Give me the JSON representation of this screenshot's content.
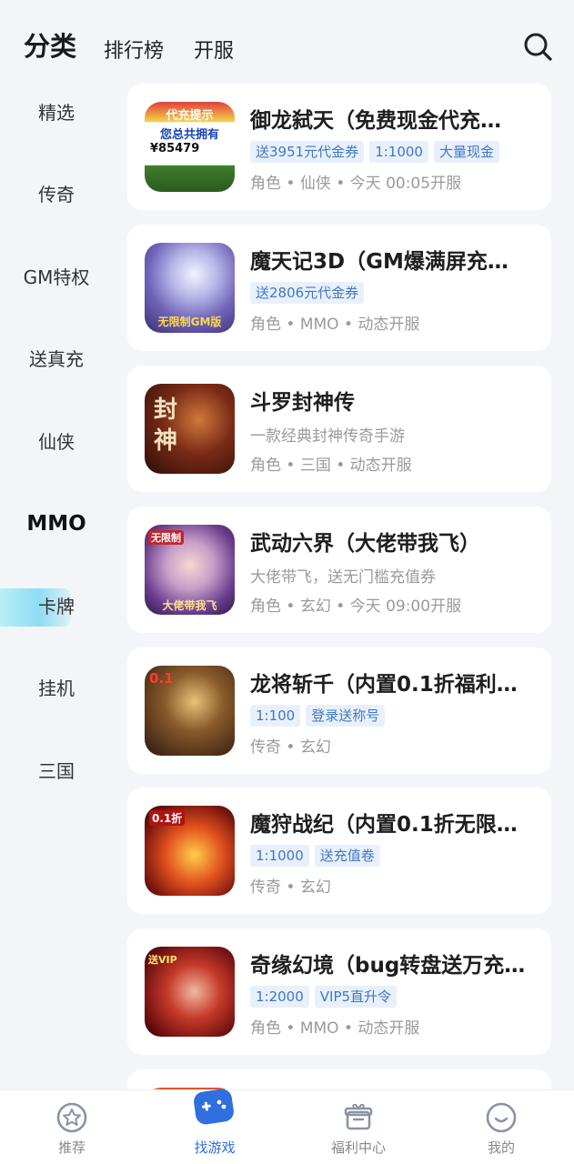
{
  "header": {
    "tab_category": "分类",
    "tab_ranking": "排行榜",
    "tab_server": "开服"
  },
  "sidebar": {
    "items": [
      {
        "label": "精选"
      },
      {
        "label": "传奇"
      },
      {
        "label": "GM特权"
      },
      {
        "label": "送真充"
      },
      {
        "label": "仙侠"
      },
      {
        "label": "MMO"
      },
      {
        "label": "卡牌"
      },
      {
        "label": "挂机"
      },
      {
        "label": "三国"
      }
    ],
    "active": "MMO"
  },
  "games": [
    {
      "title": "御龙弑天（免费现金代充…",
      "tags": [
        "送3951元代金券",
        "1:1000",
        "大量现金"
      ],
      "meta": "角色 • 仙侠 • 今天 00:05开服",
      "thumb_text_1": "代充提示",
      "thumb_text_2": "您总共拥有",
      "thumb_text_3": "¥85479"
    },
    {
      "title": "魔天记3D（GM爆满屏充…",
      "tags": [
        "送2806元代金券"
      ],
      "meta": "角色 • MMO • 动态开服",
      "thumb_text_1": "无限制GM版"
    },
    {
      "title": "斗罗封神传",
      "desc": "一款经典封神传奇手游",
      "meta": "角色 • 三国 • 动态开服",
      "thumb_text_1": "封神"
    },
    {
      "title": "武动六界（大佬带我飞）",
      "desc": "大佬带飞，送无门槛充值券",
      "meta": "角色 • 玄幻 • 今天 09:00开服",
      "thumb_text_1": "无限制",
      "thumb_text_2": "大佬带我飞"
    },
    {
      "title": "龙将斩千（内置0.1折福利…",
      "tags": [
        "1:100",
        "登录送称号"
      ],
      "meta": "传奇 • 玄幻",
      "thumb_text_1": "0.1"
    },
    {
      "title": "魔狩战纪（内置0.1折无限…",
      "tags": [
        "1:1000",
        "送充值卷"
      ],
      "meta": "传奇 • 玄幻",
      "thumb_text_1": "0.1折"
    },
    {
      "title": "奇缘幻境（bug转盘送万充…",
      "tags": [
        "1:2000",
        "VIP5直升令"
      ],
      "meta": "角色 • MMO • 动态开服",
      "thumb_text_1": "送VIP"
    }
  ],
  "bottom_nav": [
    {
      "label": "推荐",
      "icon": "star-icon"
    },
    {
      "label": "找游戏",
      "icon": "gamepad-icon",
      "active": true
    },
    {
      "label": "福利中心",
      "icon": "gift-icon"
    },
    {
      "label": "我的",
      "icon": "smiley-icon"
    }
  ],
  "colors": {
    "accent": "#2f6fe0",
    "tag_text": "#3f78c6",
    "tag_bg": "#e8f0fb",
    "background": "#f3f5f8"
  }
}
